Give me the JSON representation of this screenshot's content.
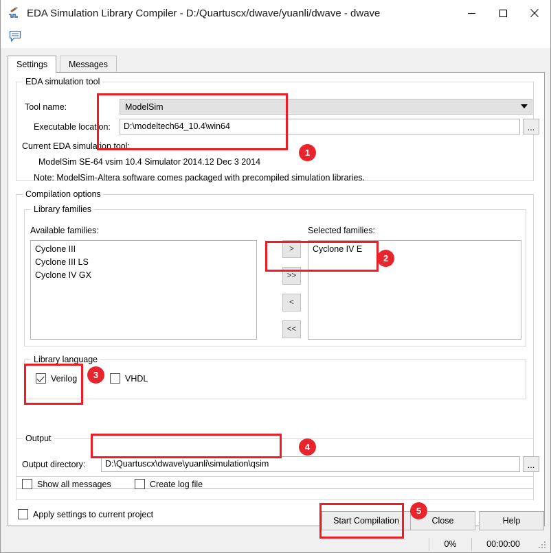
{
  "window": {
    "title": "EDA Simulation Library Compiler - D:/Quartuscx/dwave/yuanli/dwave - dwave",
    "app_icon": "compiler-icon",
    "minimize": "minimize-icon",
    "maximize": "maximize-icon",
    "close": "close-icon",
    "message_icon": "message-bubble-icon"
  },
  "tabs": [
    {
      "label": "Settings",
      "active": true
    },
    {
      "label": "Messages",
      "active": false
    }
  ],
  "eda_tool": {
    "legend": "EDA simulation tool",
    "tool_name_label": "Tool name:",
    "tool_name_value": "ModelSim",
    "executable_label": "Executable location:",
    "executable_value": "D:\\modeltech64_10.4\\win64",
    "browse_label": "...",
    "current_tool_label": "Current EDA simulation tool:",
    "current_tool_value": "ModelSim SE-64 vsim 10.4 Simulator 2014.12 Dec  3 2014",
    "note": "Note: ModelSim-Altera software comes packaged with precompiled simulation libraries."
  },
  "compilation": {
    "legend": "Compilation options",
    "library_families": {
      "legend": "Library families",
      "available_label": "Available families:",
      "available_items": [
        "Cyclone III",
        "Cyclone III LS",
        "Cyclone IV GX"
      ],
      "selected_label": "Selected families:",
      "selected_items": [
        "Cyclone IV E"
      ],
      "buttons": [
        ">",
        ">>",
        "<",
        "<<"
      ]
    },
    "library_language": {
      "legend": "Library language",
      "verilog_label": "Verilog",
      "verilog_checked": true,
      "vhdl_label": "VHDL",
      "vhdl_checked": false
    }
  },
  "output": {
    "legend": "Output",
    "directory_label": "Output directory:",
    "directory_value": "D:\\Quartuscx\\dwave\\yuanli\\simulation\\qsim",
    "browse_label": "...",
    "show_all_messages_label": "Show all messages",
    "show_all_messages_checked": false,
    "create_log_file_label": "Create log file",
    "create_log_file_checked": false
  },
  "apply_settings": {
    "label": "Apply settings to current project",
    "checked": false
  },
  "buttons": {
    "start_compilation": "Start Compilation",
    "close": "Close",
    "help": "Help"
  },
  "statusbar": {
    "percent": "0%",
    "elapsed": "00:00:00"
  },
  "annotations": [
    {
      "id": "1",
      "label": "1"
    },
    {
      "id": "2",
      "label": "2"
    },
    {
      "id": "3",
      "label": "3"
    },
    {
      "id": "4",
      "label": "4"
    },
    {
      "id": "5",
      "label": "5"
    }
  ],
  "colors": {
    "annotation_red": "#ee1c25",
    "badge_red": "#e8242c"
  }
}
